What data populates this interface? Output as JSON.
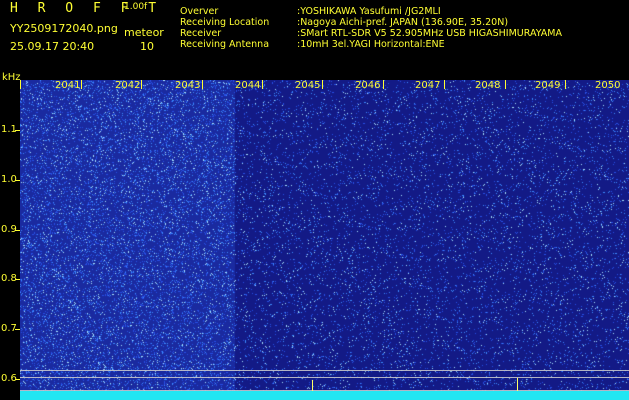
{
  "header": {
    "app_title": "H R O F F T",
    "version": "1.00f",
    "filename": "YY2509172040.png",
    "datetime": "25.09.17 20:40",
    "meteor_label": "meteor",
    "meteor_count": "10",
    "info": [
      {
        "key": "Overver",
        "value": ":YOSHIKAWA Yasufumi /JG2MLI"
      },
      {
        "key": "Receiving Location",
        "value": ":Nagoya Aichi-pref. JAPAN (136.90E, 35.20N)"
      },
      {
        "key": "Receiver",
        "value": ":SMart RTL-SDR V5 52.905MHz USB HIGASHIMURAYAMA"
      },
      {
        "key": "Receiving Antenna",
        "value": ":10mH 3el.YAGI Horizontal:ENE"
      }
    ]
  },
  "axes": {
    "y_unit": "kHz",
    "y_labels": [
      "1.1",
      "1.0",
      "0.9",
      "0.8",
      "0.7",
      "0.6"
    ],
    "x_labels": [
      "2041",
      "2042",
      "2043",
      "2044",
      "2045",
      "2046",
      "2047",
      "2048",
      "2049",
      "2050"
    ]
  },
  "colors": {
    "label": "#ffff33",
    "background_left": "#1a2aa0",
    "background_right": "#131a86",
    "noise_strip": "#22e6f2"
  }
}
